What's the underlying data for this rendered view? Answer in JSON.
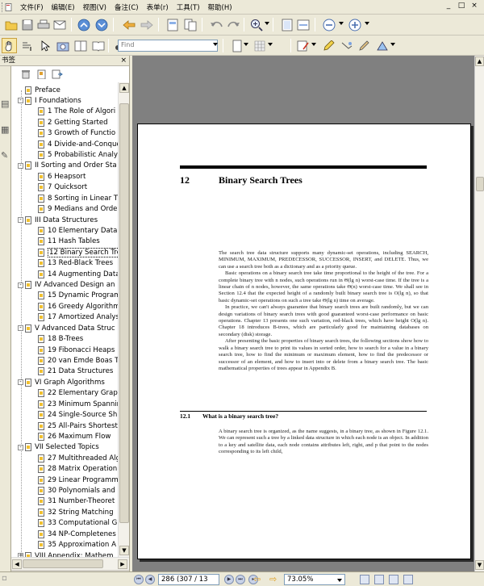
{
  "menubar": {
    "items": [
      "文件(F)",
      "编辑(E)",
      "视图(V)",
      "备注(C)",
      "表单(r)",
      "工具(T)",
      "帮助(H)"
    ],
    "window_controls": [
      "_",
      "□",
      "×"
    ]
  },
  "toolbar": {
    "find_placeholder": "Find",
    "colors": {
      "accent": "#3a6ea5",
      "bg": "#ece9d8"
    }
  },
  "bookmark_panel": {
    "title": "书签",
    "close": "×",
    "items": [
      {
        "label": "Preface",
        "level": 1,
        "exp": ""
      },
      {
        "label": "I Foundations",
        "level": 1,
        "exp": "-"
      },
      {
        "label": "1 The Role of Algori",
        "level": 2,
        "exp": ""
      },
      {
        "label": "2 Getting Started",
        "level": 2,
        "exp": ""
      },
      {
        "label": "3 Growth of Functio",
        "level": 2,
        "exp": ""
      },
      {
        "label": "4 Divide-and-Conque",
        "level": 2,
        "exp": ""
      },
      {
        "label": "5 Probabilistic Analy",
        "level": 2,
        "exp": ""
      },
      {
        "label": "II Sorting and Order Sta",
        "level": 1,
        "exp": "-"
      },
      {
        "label": "6 Heapsort",
        "level": 2,
        "exp": ""
      },
      {
        "label": "7 Quicksort",
        "level": 2,
        "exp": ""
      },
      {
        "label": "8 Sorting in Linear T",
        "level": 2,
        "exp": ""
      },
      {
        "label": "9 Medians and Orde",
        "level": 2,
        "exp": ""
      },
      {
        "label": "III Data Structures",
        "level": 1,
        "exp": "-"
      },
      {
        "label": "10 Elementary Data",
        "level": 2,
        "exp": ""
      },
      {
        "label": "11 Hash Tables",
        "level": 2,
        "exp": ""
      },
      {
        "label": "12 Binary Search Tre",
        "level": 2,
        "exp": "",
        "selected": true
      },
      {
        "label": "13 Red-Black Trees",
        "level": 2,
        "exp": ""
      },
      {
        "label": "14 Augmenting Data",
        "level": 2,
        "exp": ""
      },
      {
        "label": "IV Advanced Design an",
        "level": 1,
        "exp": "-"
      },
      {
        "label": "15 Dynamic Program",
        "level": 2,
        "exp": ""
      },
      {
        "label": "16 Greedy Algorithm",
        "level": 2,
        "exp": ""
      },
      {
        "label": "17 Amortized Analys",
        "level": 2,
        "exp": ""
      },
      {
        "label": "V Advanced Data Struc",
        "level": 1,
        "exp": "-"
      },
      {
        "label": "18 B-Trees",
        "level": 2,
        "exp": ""
      },
      {
        "label": "19 Fibonacci Heaps",
        "level": 2,
        "exp": ""
      },
      {
        "label": "20 van Emde Boas T",
        "level": 2,
        "exp": ""
      },
      {
        "label": "21 Data Structures",
        "level": 2,
        "exp": ""
      },
      {
        "label": "VI Graph Algorithms",
        "level": 1,
        "exp": "-"
      },
      {
        "label": "22 Elementary Grap",
        "level": 2,
        "exp": ""
      },
      {
        "label": "23 Minimum Spannin",
        "level": 2,
        "exp": ""
      },
      {
        "label": "24 Single-Source Sh",
        "level": 2,
        "exp": ""
      },
      {
        "label": "25 All-Pairs Shortest",
        "level": 2,
        "exp": ""
      },
      {
        "label": "26 Maximum Flow",
        "level": 2,
        "exp": ""
      },
      {
        "label": "VII Selected Topics",
        "level": 1,
        "exp": "-"
      },
      {
        "label": "27 Multithreaded Alg",
        "level": 2,
        "exp": ""
      },
      {
        "label": "28 Matrix Operation",
        "level": 2,
        "exp": ""
      },
      {
        "label": "29 Linear Programm",
        "level": 2,
        "exp": ""
      },
      {
        "label": "30 Polynomials and",
        "level": 2,
        "exp": ""
      },
      {
        "label": "31 Number-Theoret",
        "level": 2,
        "exp": ""
      },
      {
        "label": "32 String Matching",
        "level": 2,
        "exp": ""
      },
      {
        "label": "33 Computational G",
        "level": 2,
        "exp": ""
      },
      {
        "label": "34 NP-Completenes",
        "level": 2,
        "exp": ""
      },
      {
        "label": "35 Approximation A",
        "level": 2,
        "exp": ""
      },
      {
        "label": "VIII Appendix: Mathem",
        "level": 1,
        "exp": "+"
      }
    ]
  },
  "document": {
    "chapter_number": "12",
    "chapter_title": "Binary Search Trees",
    "paragraphs": [
      "The search tree data structure supports many dynamic-set operations, including SEARCH, MINIMUM, MAXIMUM, PREDECESSOR, SUCCESSOR, INSERT, and DELETE. Thus, we can use a search tree both as a dictionary and as a priority queue.",
      "Basic operations on a binary search tree take time proportional to the height of the tree. For a complete binary tree with n nodes, such operations run in Θ(lg n) worst-case time. If the tree is a linear chain of n nodes, however, the same operations take Θ(n) worst-case time. We shall see in Section 12.4 that the expected height of a randomly built binary search tree is O(lg n), so that basic dynamic-set operations on such a tree take Θ(lg n) time on average.",
      "In practice, we can't always guarantee that binary search trees are built randomly, but we can design variations of binary search trees with good guaranteed worst-case performance on basic operations. Chapter 13 presents one such variation, red-black trees, which have height O(lg n). Chapter 18 introduces B-trees, which are particularly good for maintaining databases on secondary (disk) storage.",
      "After presenting the basic properties of binary search trees, the following sections show how to walk a binary search tree to print its values in sorted order, how to search for a value in a binary search tree, how to find the minimum or maximum element, how to find the predecessor or successor of an element, and how to insert into or delete from a binary search tree. The basic mathematical properties of trees appear in Appendix B."
    ],
    "section_number": "12.1",
    "section_title": "What is a binary search tree?",
    "section_paragraph": "A binary search tree is organized, as the name suggests, in a binary tree, as shown in Figure 12.1. We can represent such a tree by a linked data structure in which each node is an object. In addition to a key and satellite data, each node contains attributes left, right, and p that point to the nodes corresponding to its left child,"
  },
  "status": {
    "page_current": "286",
    "page_of": "(307 / 13",
    "zoom": "73.05%"
  }
}
